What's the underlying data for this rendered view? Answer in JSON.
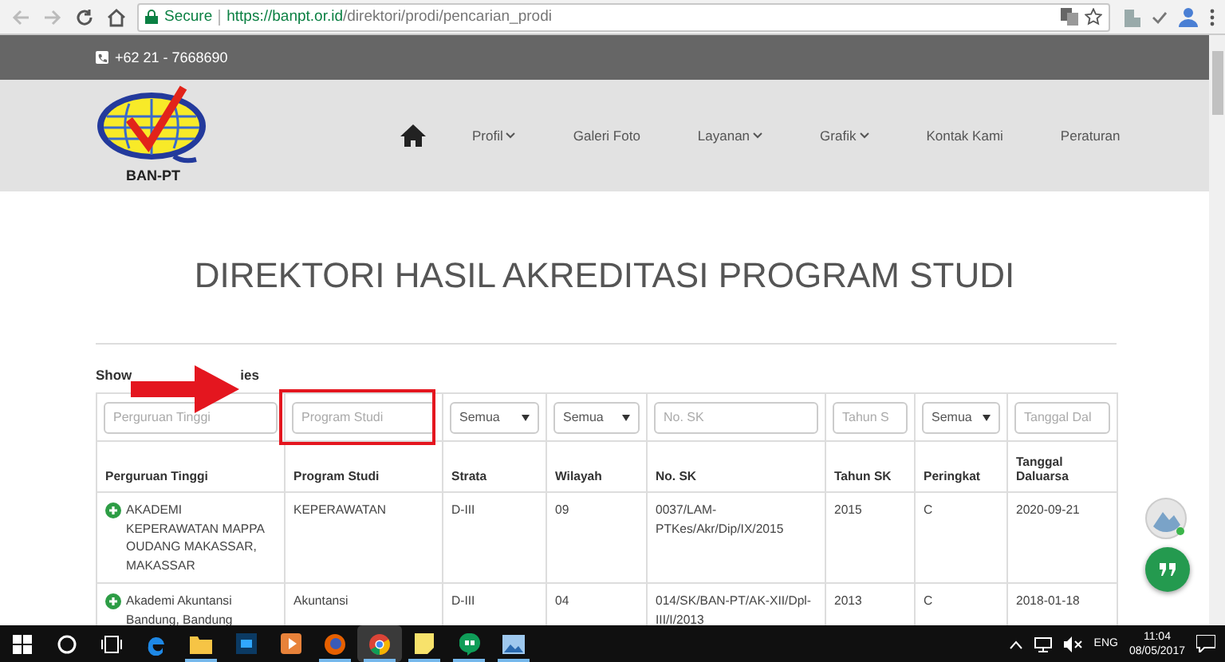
{
  "browser": {
    "secure_label": "Secure",
    "url_host": "https://banpt.or.id",
    "url_path": "/direktori/prodi/pencarian_prodi"
  },
  "topbar": {
    "phone": "+62 21 - 7668690"
  },
  "nav": {
    "logo_text": "BAN-PT",
    "items": [
      {
        "kind": "home"
      },
      {
        "kind": "link",
        "label": "Profil",
        "dropdown": true
      },
      {
        "kind": "link",
        "label": "Galeri Foto",
        "dropdown": false
      },
      {
        "kind": "link",
        "label": "Layanan",
        "dropdown": true
      },
      {
        "kind": "link",
        "label": "Grafik",
        "dropdown": true
      },
      {
        "kind": "link",
        "label": "Kontak Kami",
        "dropdown": false
      },
      {
        "kind": "link",
        "label": "Peraturan",
        "dropdown": false
      }
    ]
  },
  "title": "DIREKTORI HASIL AKREDITASI PROGRAM STUDI",
  "length_menu": {
    "show_label": "Show",
    "entries_label": "ies"
  },
  "filters": [
    {
      "kind": "text",
      "placeholder": "Perguruan Tinggi",
      "highlighted": false
    },
    {
      "kind": "text",
      "placeholder": "Program Studi",
      "highlighted": true
    },
    {
      "kind": "select",
      "value": "Semua",
      "highlighted": false
    },
    {
      "kind": "select",
      "value": "Semua",
      "highlighted": false
    },
    {
      "kind": "text",
      "placeholder": "No. SK",
      "highlighted": false
    },
    {
      "kind": "text",
      "placeholder": "Tahun S",
      "highlighted": false
    },
    {
      "kind": "select",
      "value": "Semua",
      "highlighted": false
    },
    {
      "kind": "text",
      "placeholder": "Tanggal Dal",
      "highlighted": false
    }
  ],
  "table": {
    "columns": [
      "Perguruan Tinggi",
      "Program Studi",
      "Strata",
      "Wilayah",
      "No. SK",
      "Tahun SK",
      "Peringkat",
      "Tanggal Daluarsa"
    ],
    "rows": [
      {
        "cells": [
          "AKADEMI KEPERAWATAN MAPPA OUDANG MAKASSAR, MAKASSAR",
          "KEPERAWATAN",
          "D-III",
          "09",
          "0037/LAM-PTKes/Akr/Dip/IX/2015",
          "2015",
          "C",
          "2020-09-21"
        ]
      },
      {
        "cells": [
          "Akademi Akuntansi Bandung, Bandung",
          "Akuntansi",
          "D-III",
          "04",
          "014/SK/BAN-PT/AK-XII/Dpl-III/I/2013",
          "2013",
          "C",
          "2018-01-18"
        ]
      }
    ]
  },
  "taskbar": {
    "apps": [
      {
        "kind": "edge",
        "running": false,
        "selected": false
      },
      {
        "kind": "explorer",
        "running": true,
        "selected": false
      },
      {
        "kind": "photoshop",
        "running": false,
        "selected": false
      },
      {
        "kind": "media",
        "running": false,
        "selected": false
      },
      {
        "kind": "firefox",
        "running": true,
        "selected": false
      },
      {
        "kind": "chrome",
        "running": true,
        "selected": true
      },
      {
        "kind": "notes",
        "running": true,
        "selected": false
      },
      {
        "kind": "hangouts",
        "running": true,
        "selected": false
      },
      {
        "kind": "photos",
        "running": true,
        "selected": false
      }
    ],
    "language": "ENG",
    "time": "11:04",
    "date": "08/05/2017"
  }
}
